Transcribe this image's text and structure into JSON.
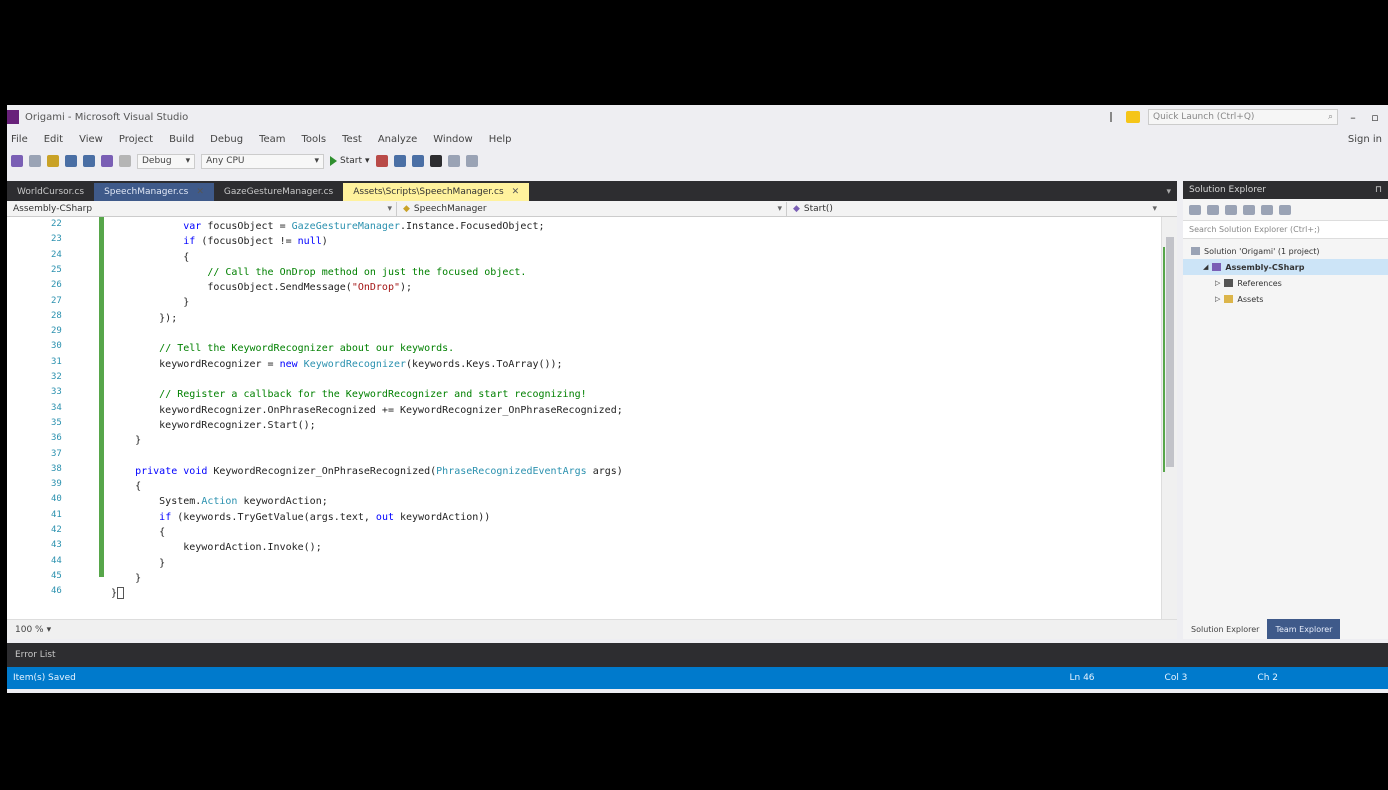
{
  "window": {
    "title": "Origami - Microsoft Visual Studio",
    "quick_launch_placeholder": "Quick Launch (Ctrl+Q)"
  },
  "menu": [
    "File",
    "Edit",
    "View",
    "Project",
    "Build",
    "Debug",
    "Team",
    "Tools",
    "Test",
    "Analyze",
    "Window",
    "Help"
  ],
  "menu_signin": "Sign in",
  "toolbar": {
    "config": "Debug",
    "platform": "Any CPU",
    "start_label": "Start"
  },
  "tabs": [
    {
      "label": "WorldCursor.cs",
      "state": "normal"
    },
    {
      "label": "SpeechManager.cs",
      "state": "preview"
    },
    {
      "label": "GazeGestureManager.cs",
      "state": "normal"
    },
    {
      "label": "Assets\\Scripts\\SpeechManager.cs",
      "state": "active"
    }
  ],
  "nav": {
    "project": "Assembly-CSharp",
    "type": "SpeechManager",
    "member": "Start()"
  },
  "code_lines": [
    {
      "n": "22",
      "tokens": [
        [
          "pl",
          "            "
        ],
        [
          "kw",
          "var"
        ],
        [
          "pl",
          " focusObject = "
        ],
        [
          "ty",
          "GazeGestureManager"
        ],
        [
          "pl",
          ".Instance.FocusedObject;"
        ]
      ]
    },
    {
      "n": "23",
      "tokens": [
        [
          "pl",
          "            "
        ],
        [
          "kw",
          "if"
        ],
        [
          "pl",
          " (focusObject != "
        ],
        [
          "kw",
          "null"
        ],
        [
          "pl",
          ")"
        ]
      ]
    },
    {
      "n": "24",
      "tokens": [
        [
          "pl",
          "            {"
        ]
      ]
    },
    {
      "n": "25",
      "tokens": [
        [
          "pl",
          "                "
        ],
        [
          "cm",
          "// Call the OnDrop method on just the focused object."
        ]
      ]
    },
    {
      "n": "26",
      "tokens": [
        [
          "pl",
          "                focusObject.SendMessage("
        ],
        [
          "st",
          "\"OnDrop\""
        ],
        [
          "pl",
          ");"
        ]
      ]
    },
    {
      "n": "27",
      "tokens": [
        [
          "pl",
          "            }"
        ]
      ]
    },
    {
      "n": "28",
      "tokens": [
        [
          "pl",
          "        });"
        ]
      ]
    },
    {
      "n": "29",
      "tokens": [
        [
          "pl",
          ""
        ]
      ]
    },
    {
      "n": "30",
      "tokens": [
        [
          "pl",
          "        "
        ],
        [
          "cm",
          "// Tell the KeywordRecognizer about our keywords."
        ]
      ]
    },
    {
      "n": "31",
      "tokens": [
        [
          "pl",
          "        keywordRecognizer = "
        ],
        [
          "kw",
          "new"
        ],
        [
          "pl",
          " "
        ],
        [
          "ty",
          "KeywordRecognizer"
        ],
        [
          "pl",
          "(keywords.Keys.ToArray());"
        ]
      ]
    },
    {
      "n": "32",
      "tokens": [
        [
          "pl",
          ""
        ]
      ]
    },
    {
      "n": "33",
      "tokens": [
        [
          "pl",
          "        "
        ],
        [
          "cm",
          "// Register a callback for the KeywordRecognizer and start recognizing!"
        ]
      ]
    },
    {
      "n": "34",
      "tokens": [
        [
          "pl",
          "        keywordRecognizer.OnPhraseRecognized += KeywordRecognizer_OnPhraseRecognized;"
        ]
      ]
    },
    {
      "n": "35",
      "tokens": [
        [
          "pl",
          "        keywordRecognizer.Start();"
        ]
      ]
    },
    {
      "n": "36",
      "tokens": [
        [
          "pl",
          "    }"
        ]
      ]
    },
    {
      "n": "37",
      "tokens": [
        [
          "pl",
          ""
        ]
      ]
    },
    {
      "n": "38",
      "tokens": [
        [
          "pl",
          "    "
        ],
        [
          "kw",
          "private"
        ],
        [
          "pl",
          " "
        ],
        [
          "kw",
          "void"
        ],
        [
          "pl",
          " KeywordRecognizer_OnPhraseRecognized("
        ],
        [
          "ty",
          "PhraseRecognizedEventArgs"
        ],
        [
          "pl",
          " args)"
        ]
      ]
    },
    {
      "n": "39",
      "tokens": [
        [
          "pl",
          "    {"
        ]
      ]
    },
    {
      "n": "40",
      "tokens": [
        [
          "pl",
          "        System."
        ],
        [
          "ty",
          "Action"
        ],
        [
          "pl",
          " keywordAction;"
        ]
      ]
    },
    {
      "n": "41",
      "tokens": [
        [
          "pl",
          "        "
        ],
        [
          "kw",
          "if"
        ],
        [
          "pl",
          " (keywords.TryGetValue(args.text, "
        ],
        [
          "kw",
          "out"
        ],
        [
          "pl",
          " keywordAction))"
        ]
      ]
    },
    {
      "n": "42",
      "tokens": [
        [
          "pl",
          "        {"
        ]
      ]
    },
    {
      "n": "43",
      "tokens": [
        [
          "pl",
          "            keywordAction.Invoke();"
        ]
      ]
    },
    {
      "n": "44",
      "tokens": [
        [
          "pl",
          "        }"
        ]
      ]
    },
    {
      "n": "45",
      "tokens": [
        [
          "pl",
          "    }"
        ]
      ]
    },
    {
      "n": "46",
      "tokens": [
        [
          "pl",
          "}"
        ]
      ]
    }
  ],
  "editor_footer": {
    "zoom": "100 %"
  },
  "solution_explorer": {
    "title": "Solution Explorer",
    "search_placeholder": "Search Solution Explorer (Ctrl+;)",
    "nodes": [
      {
        "label": "Solution 'Origami' (1 project)",
        "indent": 0,
        "selected": false
      },
      {
        "label": "Assembly-CSharp",
        "indent": 1,
        "selected": true
      },
      {
        "label": "References",
        "indent": 2,
        "selected": false
      },
      {
        "label": "Assets",
        "indent": 2,
        "selected": false
      }
    ],
    "tab_se": "Solution Explorer",
    "tab_te": "Team Explorer"
  },
  "error_list": "Error List",
  "status": {
    "left": "Item(s) Saved",
    "ln": "Ln 46",
    "col": "Col 3",
    "ch": "Ch 2"
  },
  "colors": {
    "accent": "#007acc",
    "active_tab": "#fff29d",
    "change_margin": "#57a64a"
  }
}
